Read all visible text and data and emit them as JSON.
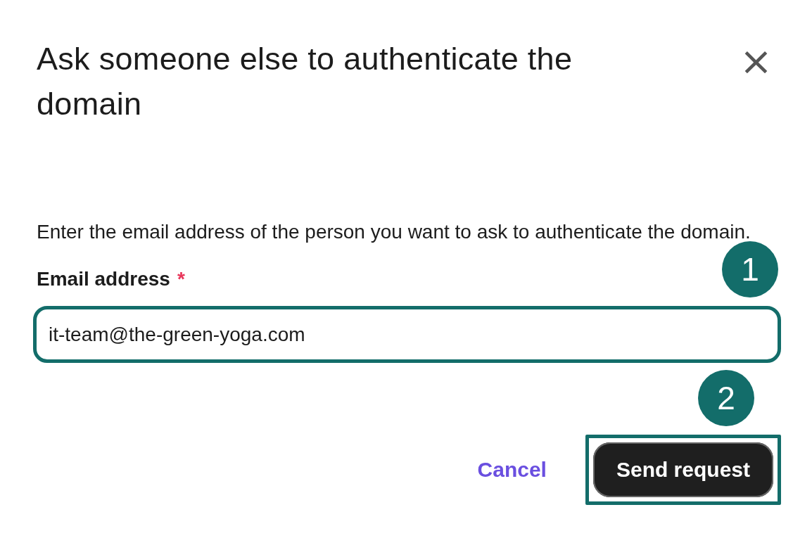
{
  "dialog": {
    "title": "Ask someone else to authenticate the domain",
    "close_label": "×",
    "description": "Enter the email address of the person you want to ask to authenticate the domain.",
    "field": {
      "label": "Email address",
      "required_mark": "*",
      "value": "it-team@the-green-yoga.com",
      "highlighted": true,
      "step": "1"
    },
    "buttons": [
      {
        "kind": "link",
        "label": "Cancel",
        "highlighted": false
      },
      {
        "kind": "primary",
        "label": "Send request",
        "highlighted": true,
        "step": "2"
      }
    ]
  }
}
